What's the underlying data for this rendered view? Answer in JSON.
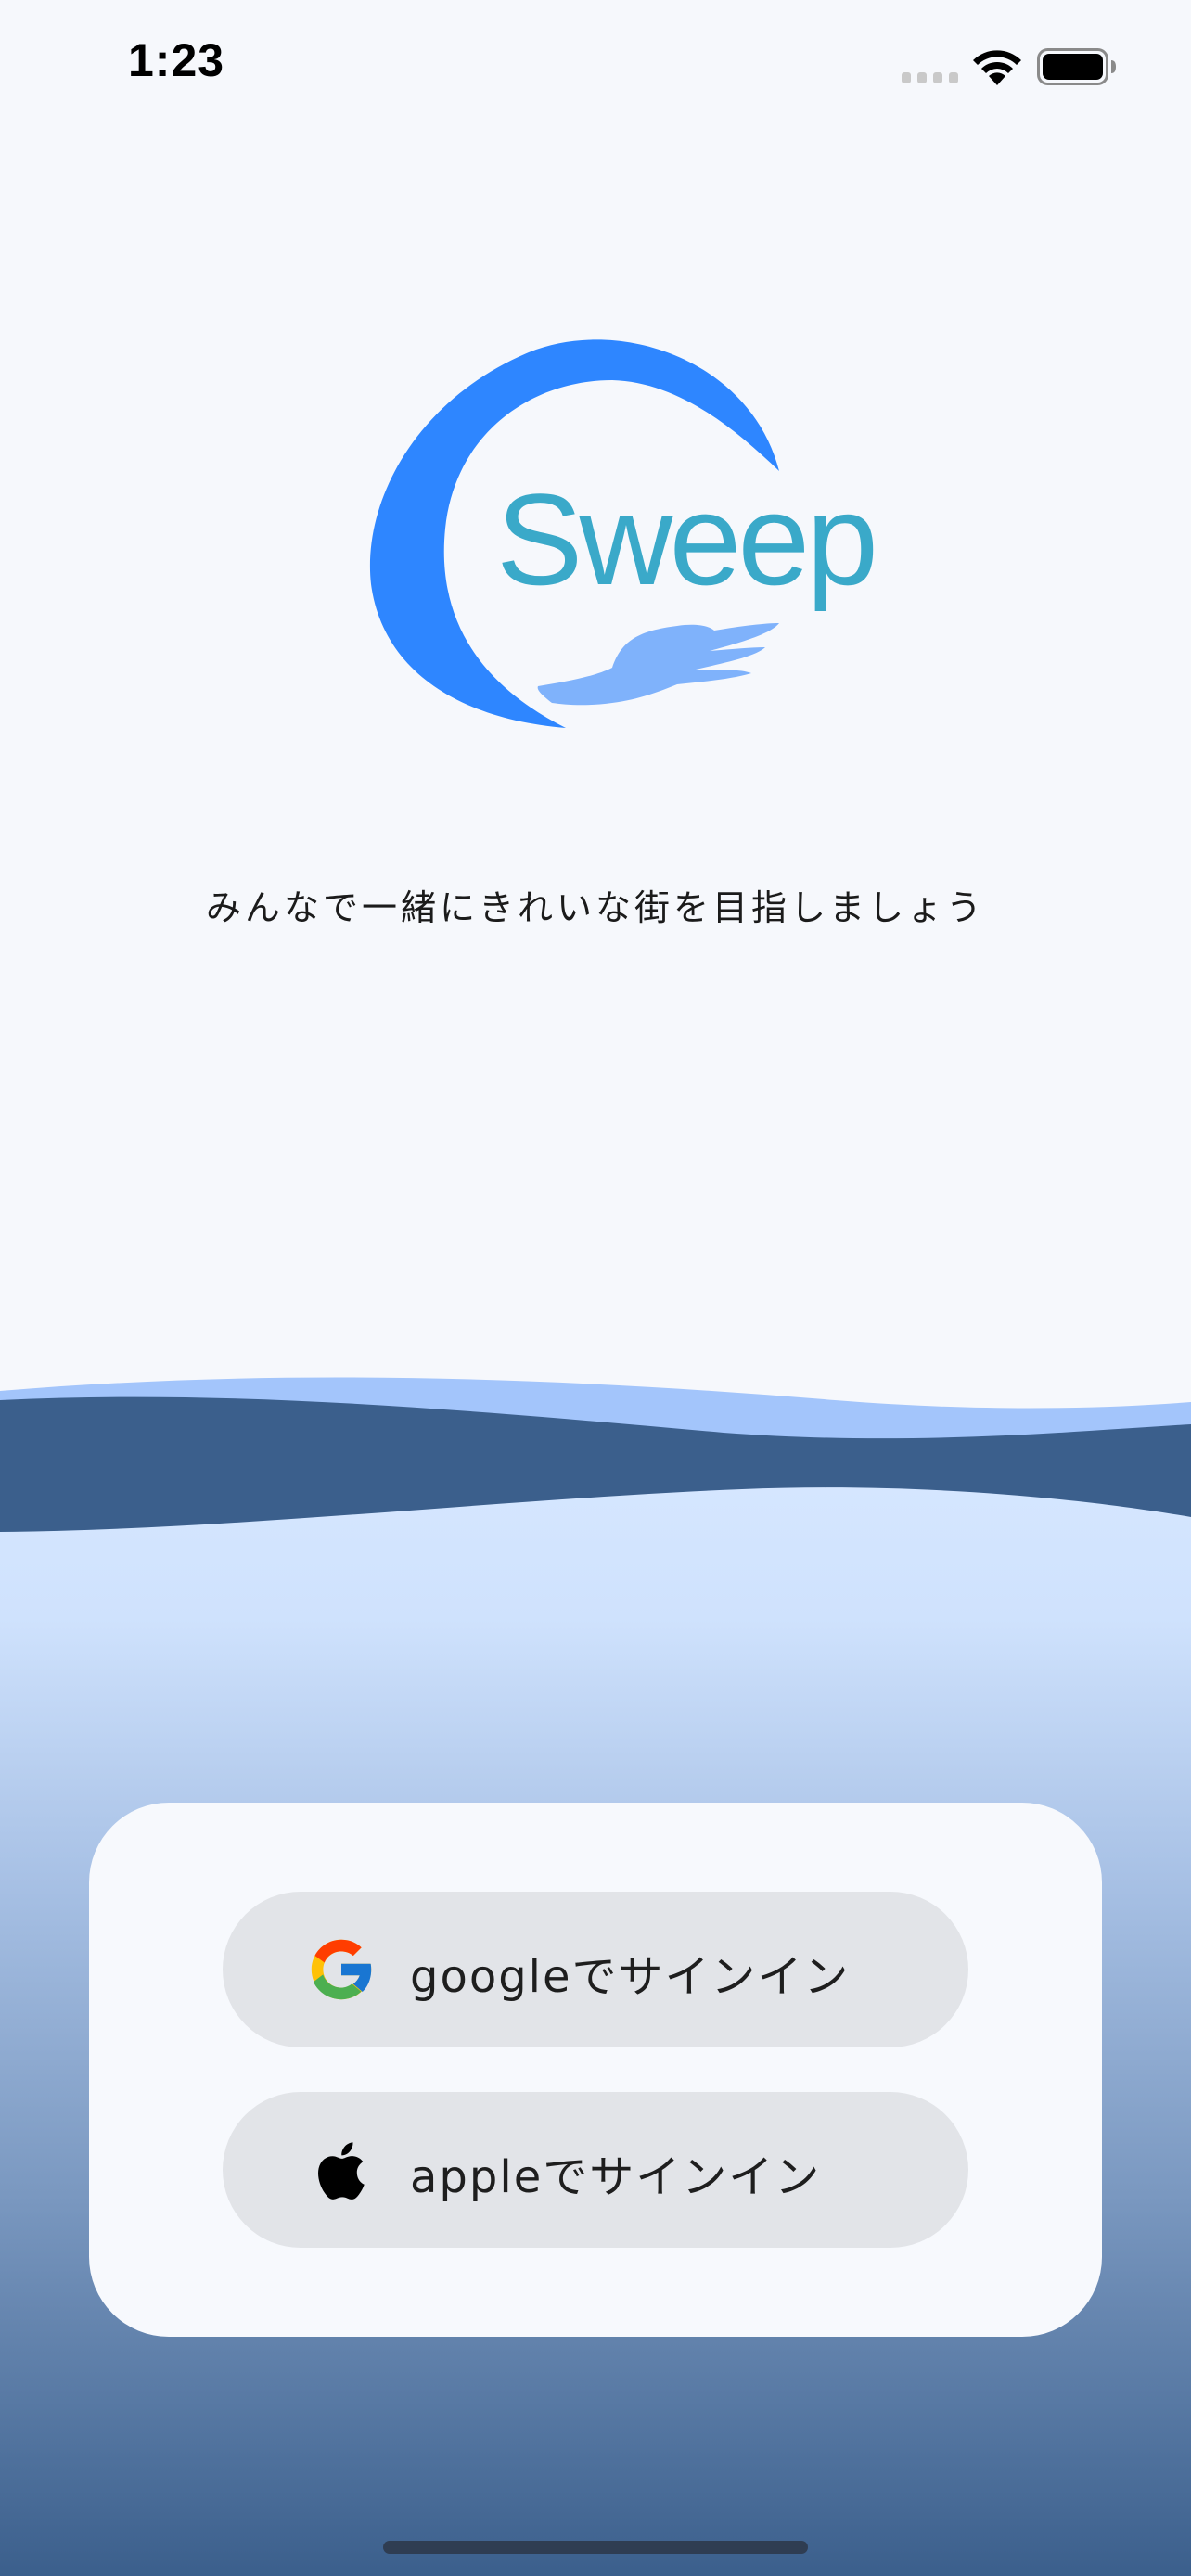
{
  "status_bar": {
    "time": "1:23",
    "icons": [
      "cellular-signal-icon",
      "wifi-icon",
      "battery-icon"
    ]
  },
  "logo": {
    "text": "Sweep",
    "colors": {
      "swoosh": "#2e86ff",
      "wordmark": "#3aa9c9",
      "hand": "#7fb2fb"
    }
  },
  "tagline": "みんなで一緒にきれいな街を目指しましょう",
  "signin": {
    "google": {
      "label": "googleでサインイン",
      "icon": "google-icon"
    },
    "apple": {
      "label": "appleでサインイン",
      "icon": "apple-icon"
    }
  },
  "colors": {
    "background": "#f6f8fc",
    "wave_light": "#a3c5fb",
    "wave_dark": "#3b5f8c",
    "gradient_top": "#d5e6ff",
    "gradient_bottom": "#3b5f8c",
    "button_bg": "#e2e4e8",
    "card_bg": "#f7f9fd"
  }
}
